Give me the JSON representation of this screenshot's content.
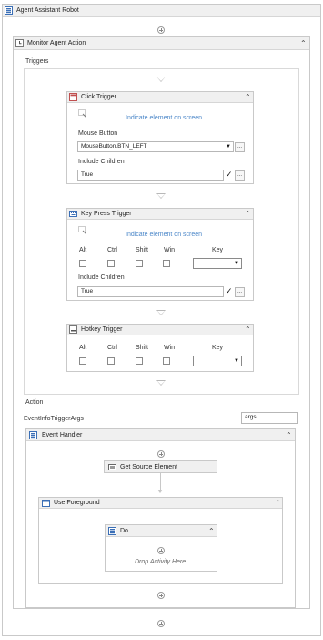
{
  "robot": {
    "title": "Agent Assistant Robot",
    "icon": "sequence-icon"
  },
  "monitor": {
    "title": "Monitor Agent Action",
    "icon": "monitor-icon"
  },
  "triggers": {
    "label": "Triggers"
  },
  "click_trigger": {
    "title": "Click Trigger",
    "indicate": "Indicate element on screen",
    "mouse_button_label": "Mouse Button",
    "mouse_button_value": "MouseButton.BTN_LEFT",
    "include_children_label": "Include Children",
    "include_children_value": "True",
    "ellipsis": "..."
  },
  "key_press_trigger": {
    "title": "Key Press Trigger",
    "indicate": "Indicate element on screen",
    "alt": "Alt",
    "ctrl": "Ctrl",
    "shift": "Shift",
    "win": "Win",
    "key": "Key",
    "include_children_label": "Include Children",
    "include_children_value": "True",
    "ellipsis": "..."
  },
  "hotkey_trigger": {
    "title": "Hotkey Trigger",
    "alt": "Alt",
    "ctrl": "Ctrl",
    "shift": "Shift",
    "win": "Win",
    "key": "Key"
  },
  "action": {
    "label": "Action",
    "args_type": "EventInfoTriggerArgs",
    "args_name": "args"
  },
  "event_handler": {
    "title": "Event Handler"
  },
  "get_source": {
    "title": "Get Source Element"
  },
  "use_foreground": {
    "title": "Use Foreground"
  },
  "do_block": {
    "title": "Do",
    "drop_text": "Drop Activity Here"
  },
  "colors": {
    "link": "#4a86c8",
    "header_bg": "#f0f0f0",
    "border": "#c9c9c9"
  }
}
